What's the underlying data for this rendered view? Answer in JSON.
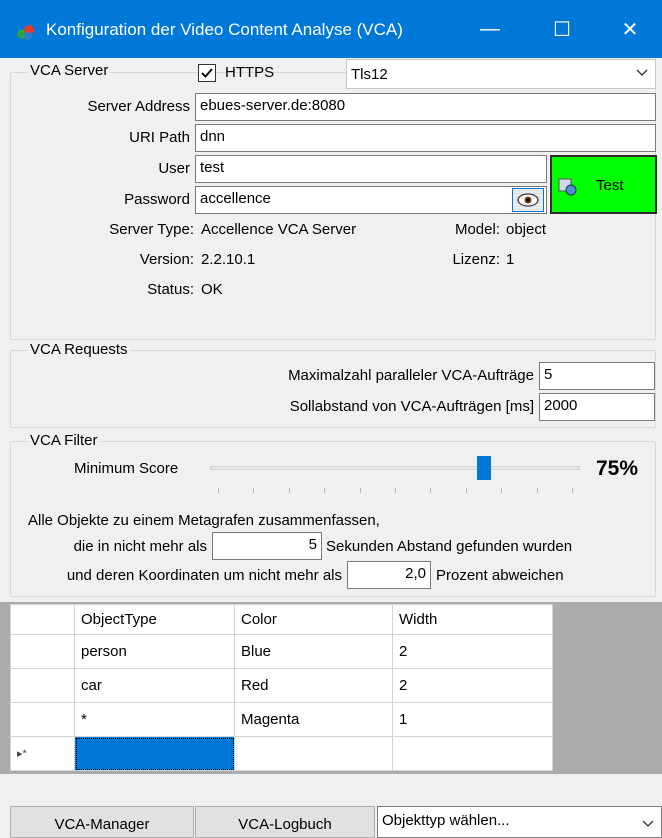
{
  "window": {
    "title": "Konfiguration der Video Content Analyse (VCA)",
    "minimize": "—",
    "maximize": "☐",
    "close": "✕"
  },
  "vca_server": {
    "legend": "VCA Server",
    "https_label": "HTTPS",
    "https_checked": true,
    "tls_value": "Tls12",
    "server_address_label": "Server Address",
    "server_address": "ebues-server.de:8080",
    "uri_path_label": "URI Path",
    "uri_path": "dnn",
    "user_label": "User",
    "user": "test",
    "password_label": "Password",
    "password": "accellence",
    "test_button": "Test",
    "test_button_color": "#00ff00",
    "server_type_label": "Server Type:",
    "server_type": "Accellence VCA Server",
    "model_label": "Model:",
    "model": "object",
    "version_label": "Version:",
    "version": "2.2.10.1",
    "lizenz_label": "Lizenz:",
    "lizenz": "1",
    "status_label": "Status:",
    "status": "OK"
  },
  "vca_requests": {
    "legend": "VCA Requests",
    "max_parallel_label": "Maximalzahl paralleler VCA-Aufträge",
    "max_parallel": "5",
    "interval_label": "Sollabstand von VCA-Aufträgen [ms]",
    "interval": "2000"
  },
  "vca_filter": {
    "legend": "VCA Filter",
    "min_score_label": "Minimum Score",
    "min_score_value": "75%",
    "min_score_fraction": 0.75,
    "merge_line1": "Alle Objekte zu einem Metagrafen zusammenfassen,",
    "merge_line2_prefix": "die in nicht mehr als",
    "seconds": "5",
    "merge_line2_suffix": "Sekunden Abstand gefunden wurden",
    "merge_line3_prefix": "und deren Koordinaten um nicht mehr als",
    "percent": "2,0",
    "merge_line3_suffix": "Prozent abweichen"
  },
  "grid": {
    "columns": [
      "ObjectType",
      "Color",
      "Width"
    ],
    "rows": [
      {
        "type": "person",
        "color": "Blue",
        "width": "2"
      },
      {
        "type": "car",
        "color": "Red",
        "width": "2"
      },
      {
        "type": "*",
        "color": "Magenta",
        "width": "1"
      }
    ],
    "new_row_marker": "▸*"
  },
  "bottom": {
    "vca_manager": "VCA-Manager",
    "vca_logbuch": "VCA-Logbuch",
    "objecttype_placeholder": "Objekttyp wählen..."
  },
  "colors": {
    "accent": "#0078d7",
    "selected_cell": "#0078d7",
    "test_green": "#00ff00"
  }
}
